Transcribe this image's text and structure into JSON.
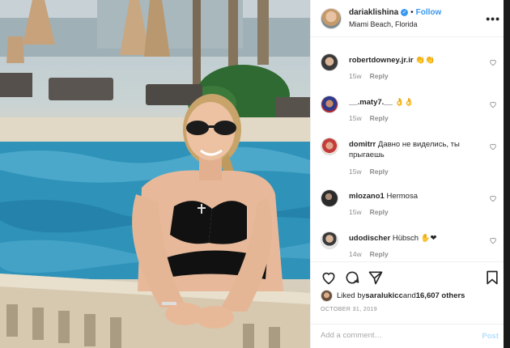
{
  "post": {
    "username": "dariaklishina",
    "follow_label": "Follow",
    "dot": "•",
    "location": "Miami Beach, Florida",
    "more_label": "•••"
  },
  "comments": [
    {
      "user": "robertdowney.jr.ir",
      "text": "👏👏",
      "time": "15w",
      "reply": "Reply"
    },
    {
      "user": "__.maty7.__",
      "text": "👌👌",
      "time": "15w",
      "reply": "Reply"
    },
    {
      "user": "domitrr",
      "text": "Давно не виделись, ты прыгаешь",
      "time": "15w",
      "reply": "Reply"
    },
    {
      "user": "mlozano1",
      "text": "Hermosa",
      "time": "15w",
      "reply": "Reply"
    },
    {
      "user": "udodischer",
      "text": "Hübsch ✋❤",
      "time": "14w",
      "reply": "Reply"
    }
  ],
  "likes": {
    "prefix": "Liked by ",
    "user": "saralukicc",
    "middle": " and ",
    "count": "16,607 others"
  },
  "date": "OCTOBER 31, 2019",
  "add_comment": {
    "placeholder": "Add a comment…",
    "post_label": "Post"
  },
  "colors": {
    "accent": "#3897f0",
    "muted": "#8e8e8e",
    "post_disabled": "#b2dffc"
  },
  "icons": [
    "heart-icon",
    "comment-icon",
    "share-icon",
    "bookmark-icon",
    "more-icon",
    "verified-icon"
  ]
}
